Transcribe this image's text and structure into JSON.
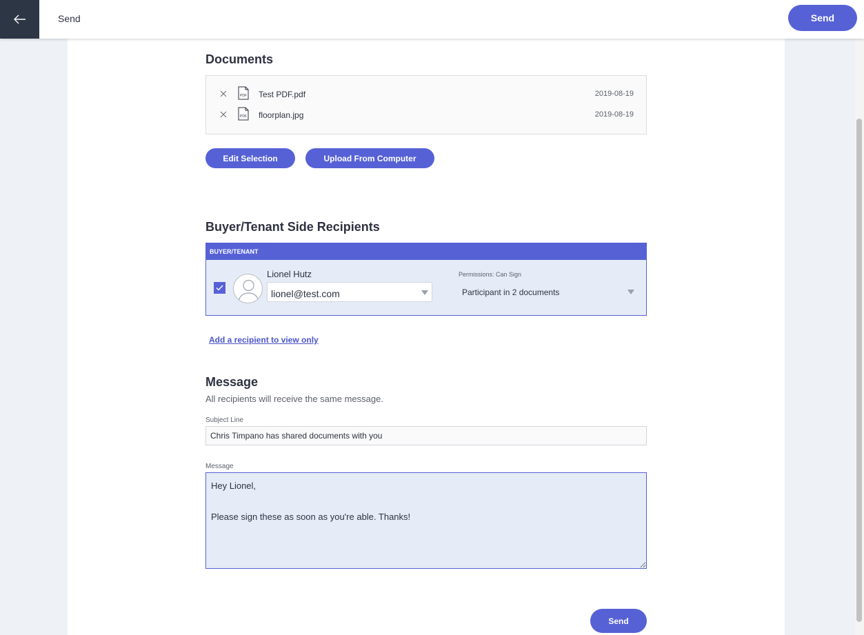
{
  "topbar": {
    "back_icon": "arrow-left-icon",
    "title": "Send",
    "send_label": "Send"
  },
  "documents": {
    "heading": "Documents",
    "items": [
      {
        "name": "Test PDF.pdf",
        "date": "2019-08-19",
        "icon": "pdf-file-icon",
        "icon_text": "PDF"
      },
      {
        "name": "floorplan.jpg",
        "date": "2019-08-19",
        "icon": "pdf-file-icon",
        "icon_text": "PDF"
      }
    ],
    "edit_selection_label": "Edit Selection",
    "upload_label": "Upload From Computer"
  },
  "recipients": {
    "heading": "Buyer/Tenant Side Recipients",
    "group_label": "BUYER/TENANT",
    "list": [
      {
        "name": "Lionel Hutz",
        "email": "lionel@test.com",
        "checked": true,
        "permissions_label": "Permissions: Can Sign",
        "participation": "Participant in 2 documents"
      }
    ],
    "add_view_only_link": "Add a recipient to view only"
  },
  "message": {
    "heading": "Message",
    "subtext": "All recipients will receive the same message.",
    "subject_label": "Subject Line",
    "subject_value": "Chris Timpano has shared documents with you",
    "message_label": "Message",
    "message_value": "Hey Lionel,\n\n\nPlease sign these as soon as you're able. Thanks!"
  },
  "footer": {
    "send_label": "Send"
  },
  "colors": {
    "accent": "#5661d6",
    "dark": "#2d3645",
    "selected_bg": "#e6ecf7"
  }
}
